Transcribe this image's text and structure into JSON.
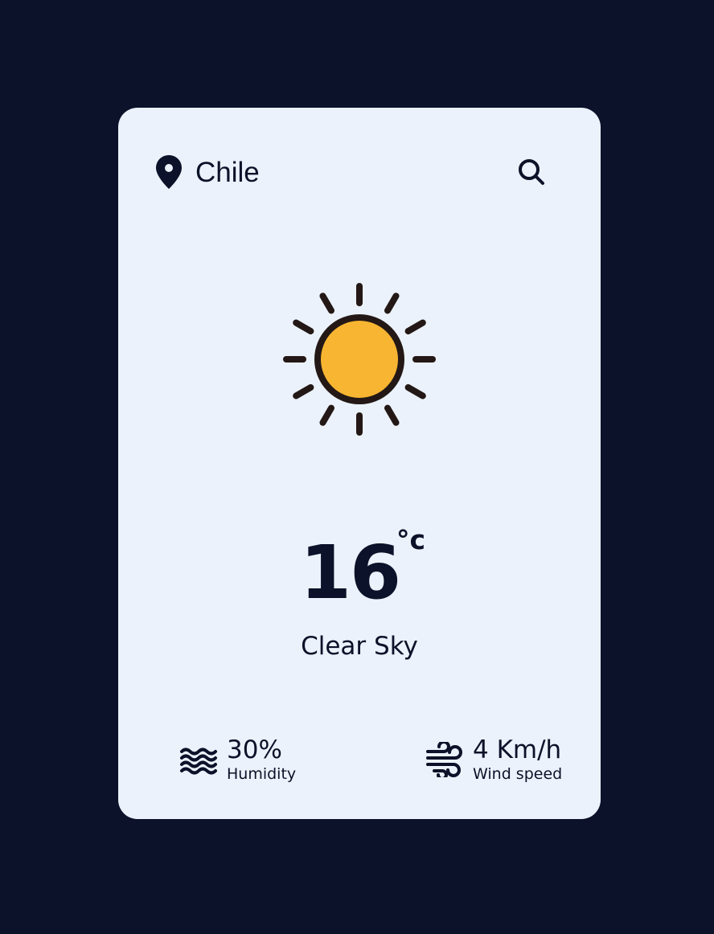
{
  "location": {
    "name": "Chile",
    "icon": "map-pin-icon"
  },
  "search": {
    "icon": "search-icon"
  },
  "weather": {
    "icon": "sun-icon",
    "temperature": "16",
    "unit": "°c",
    "condition": "Clear Sky"
  },
  "humidity": {
    "icon": "waves-icon",
    "value": "30%",
    "label": "Humidity"
  },
  "wind": {
    "icon": "wind-icon",
    "value": "4 Km/h",
    "label": "Wind speed"
  },
  "colors": {
    "background": "#0b1229",
    "card": "#ebf2fb",
    "text": "#0b1229",
    "sun_fill": "#f8b531",
    "sun_stroke": "#231815"
  }
}
